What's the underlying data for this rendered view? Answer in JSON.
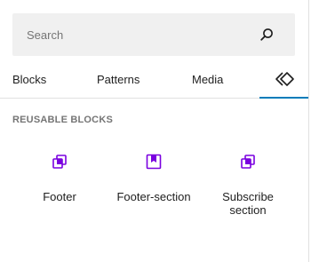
{
  "search": {
    "placeholder": "Search",
    "icon": "search-icon"
  },
  "tabs": [
    {
      "label": "Blocks"
    },
    {
      "label": "Patterns"
    },
    {
      "label": "Media"
    },
    {
      "label": "",
      "icon": "reusable-blocks-icon",
      "active": true
    }
  ],
  "section": {
    "title": "REUSABLE BLOCKS"
  },
  "blocks": [
    {
      "label": "Footer",
      "icon": "reusable-block-icon"
    },
    {
      "label": "Footer-section",
      "icon": "bookmark-block-icon"
    },
    {
      "label": "Subscribe section",
      "icon": "reusable-block-icon"
    }
  ],
  "colors": {
    "accent": "#007cba",
    "icon_purple": "#7a00df",
    "search_bg": "#f0f0f0"
  }
}
